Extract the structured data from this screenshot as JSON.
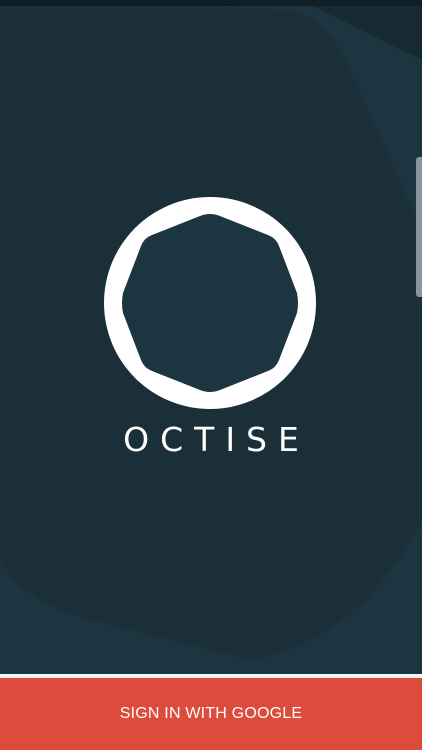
{
  "app": {
    "brand_name": "OCTISE",
    "logo_icon": "octagon-ring-logo-icon"
  },
  "actions": {
    "sign_in_label": "SIGN IN WITH GOOGLE"
  },
  "colors": {
    "background": "#1d3540",
    "background_dark_shape": "#172b33",
    "button": "#dc4b3b",
    "logo": "#ffffff"
  }
}
